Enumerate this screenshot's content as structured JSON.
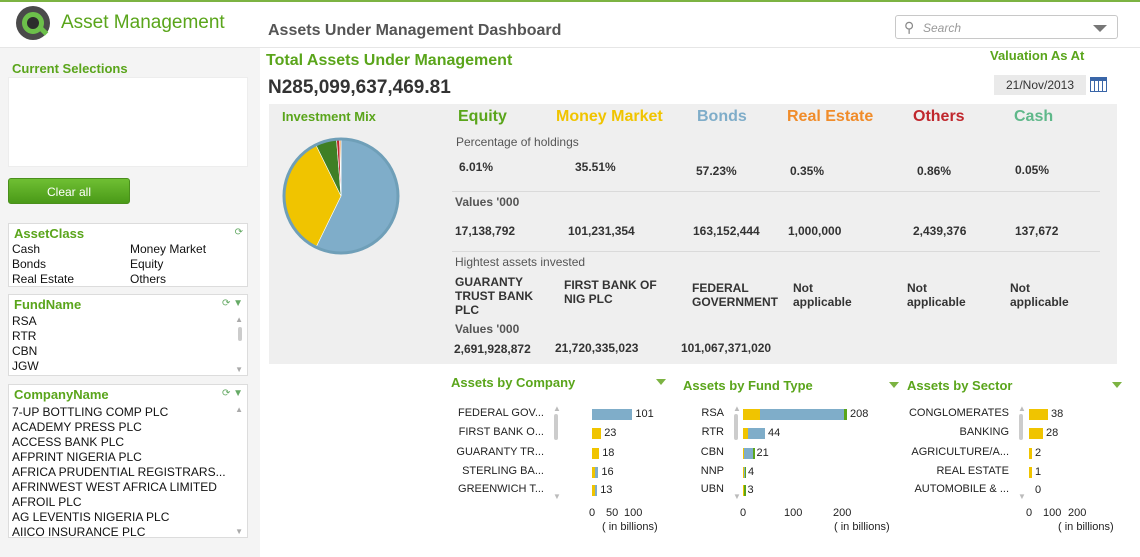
{
  "app": {
    "title": "Asset Management",
    "sheet_title": "Assets Under Management Dashboard"
  },
  "search": {
    "placeholder": "Search"
  },
  "current_selections": {
    "title": "Current Selections",
    "clear_label": "Clear all"
  },
  "listboxes": {
    "asset_class": {
      "title": "AssetClass",
      "items": [
        "Cash",
        "Money Market",
        "Bonds",
        "Equity",
        "Real Estate",
        "Others"
      ]
    },
    "fund_name": {
      "title": "FundName",
      "items": [
        "RSA",
        "RTR",
        "CBN",
        "JGW"
      ]
    },
    "company_name": {
      "title": "CompanyName",
      "items": [
        "7-UP BOTTLING COMP PLC",
        "ACADEMY PRESS PLC",
        "ACCESS BANK PLC",
        "AFPRINT NIGERIA PLC",
        "AFRICA PRUDENTIAL REGISTRARS...",
        "AFRINWEST WEST AFRICA LIMITED",
        "AFROIL PLC",
        "AG LEVENTIS NIGERIA PLC",
        "AIICO INSURANCE PLC"
      ]
    }
  },
  "total": {
    "title": "Total Assets Under Management",
    "value": "N285,099,637,469.81"
  },
  "valuation": {
    "label": "Valuation As At",
    "date": "21/Nov/2013"
  },
  "mix": {
    "title": "Investment Mix",
    "pct_label": "Percentage of holdings",
    "values_label": "Values '000",
    "highest_label": "Hightest assets invested",
    "highest_values_label": "Values '000",
    "columns": [
      {
        "name": "Equity",
        "color": "#5aa51b",
        "pct": "6.01%",
        "value": "17,138,792",
        "highest": "GUARANTY TRUST BANK PLC",
        "highest_value": "2,691,928,872"
      },
      {
        "name": "Money Market",
        "color": "#f0c400",
        "pct": "35.51%",
        "value": "101,231,354",
        "highest": "FIRST BANK OF NIG PLC",
        "highest_value": "21,720,335,023"
      },
      {
        "name": "Bonds",
        "color": "#7fadc9",
        "pct": "57.23%",
        "value": "163,152,444",
        "highest": "FEDERAL GOVERNMENT",
        "highest_value": "101,067,371,020"
      },
      {
        "name": "Real Estate",
        "color": "#f08c2a",
        "pct": "0.35%",
        "value": "1,000,000",
        "highest": "Not applicable",
        "highest_value": ""
      },
      {
        "name": "Others",
        "color": "#c0272d",
        "pct": "0.86%",
        "value": "2,439,376",
        "highest": "Not applicable",
        "highest_value": ""
      },
      {
        "name": "Cash",
        "color": "#5fb88a",
        "pct": "0.05%",
        "value": "137,672",
        "highest": "Not applicable",
        "highest_value": ""
      }
    ]
  },
  "chart_data": [
    {
      "type": "pie",
      "title": "Investment Mix",
      "categories": [
        "Bonds",
        "Money Market",
        "Equity",
        "Others",
        "Real Estate",
        "Cash"
      ],
      "values": [
        57.23,
        35.51,
        6.01,
        0.86,
        0.35,
        0.05
      ],
      "colors": [
        "#7fadc9",
        "#f0c400",
        "#3f7f25",
        "#c0272d",
        "#f08c2a",
        "#5fb88a"
      ]
    },
    {
      "type": "bar",
      "title": "Assets by Company",
      "categories": [
        "FEDERAL GOV...",
        "FIRST BANK O...",
        "GUARANTY TR...",
        "STERLING BA...",
        "GREENWICH T..."
      ],
      "values": [
        101,
        23,
        18,
        16,
        13
      ],
      "x_ticks": [
        "0",
        "50",
        "100"
      ],
      "xlim": [
        0,
        100
      ],
      "unit": "( in billions)",
      "dominant_colors": [
        "#7fadc9",
        "#f0c400",
        "#f0c400",
        "#7fadc9",
        "#7fadc9"
      ]
    },
    {
      "type": "bar",
      "title": "Assets by Fund Type",
      "categories": [
        "RSA",
        "RTR",
        "CBN",
        "NNP",
        "UBN"
      ],
      "series": [
        {
          "values": [
            34,
            10,
            2,
            1,
            1
          ],
          "color": "#f0c400"
        },
        {
          "values": [
            167,
            34,
            18,
            2,
            1
          ],
          "color": "#7fadc9"
        },
        {
          "values": [
            7,
            0,
            1,
            1,
            1
          ],
          "color": "#5aa51b"
        }
      ],
      "totals": [
        208,
        44,
        21,
        4,
        3
      ],
      "x_ticks": [
        "0",
        "100",
        "200"
      ],
      "xlim": [
        0,
        200
      ],
      "unit": "( in billions)"
    },
    {
      "type": "bar",
      "title": "Assets by Sector",
      "categories": [
        "CONGLOMERATES",
        "BANKING",
        "AGRICULTURE/A...",
        "REAL ESTATE",
        "AUTOMOBILE & ..."
      ],
      "values": [
        38,
        28,
        2,
        1,
        0
      ],
      "x_ticks": [
        "0",
        "100",
        "200"
      ],
      "xlim": [
        0,
        200
      ],
      "unit": "( in billions)",
      "color": "#f0c400"
    }
  ]
}
